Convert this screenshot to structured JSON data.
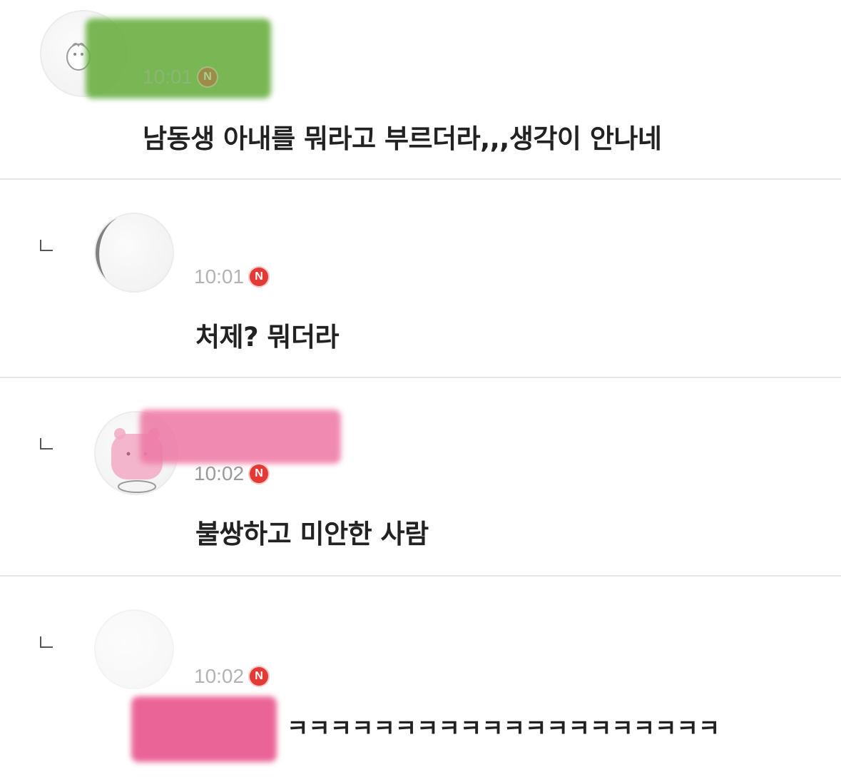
{
  "colors": {
    "name_blur_1": "#6db146",
    "name_blur_3": "#ee7aa7",
    "name_blur_4": "#e74a86",
    "badge": "#e33a36"
  },
  "comments": [
    {
      "time": "10:01",
      "badge": "N",
      "text": "남동생 아내를 뭐라고 부르더라,,,생각이 안나네",
      "is_reply": false
    },
    {
      "time": "10:01",
      "badge": "N",
      "text": "처제? 뭐더라",
      "is_reply": true
    },
    {
      "time": "10:02",
      "badge": "N",
      "text": "불쌍하고 미안한 사람",
      "is_reply": true
    },
    {
      "time": "10:02",
      "badge": "N",
      "text": "ㅋㅋㅋㅋㅋㅋㅋㅋㅋㅋㅋㅋㅋㅋㅋㅋㅋㅋㅋㅋ",
      "is_reply": true
    }
  ]
}
